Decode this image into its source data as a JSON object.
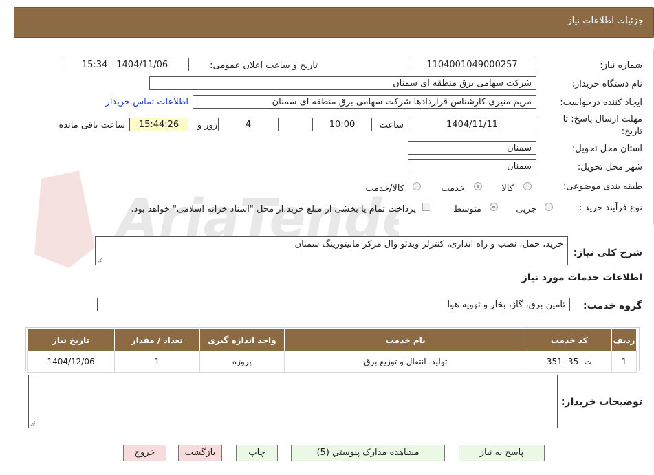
{
  "header": {
    "title": "جزئيات اطلاعات نياز"
  },
  "fields": {
    "need_number_label": "شماره نیاز:",
    "need_number": "1104001049000257",
    "announce_label": "تاریخ و ساعت اعلان عمومی:",
    "announce_value": "1404/11/06 - 15:34",
    "buyer_org_label": "نام دستگاه خریدار:",
    "buyer_org": "شرکت سهامی برق منطقه ای سمنان",
    "creator_label": "ایجاد کننده درخواست:",
    "creator": "مریم منیری کارشناس قراردادها شرکت سهامی برق منطقه ای سمنان",
    "contact_link": "اطلاعات تماس خریدار",
    "deadline_label": "مهلت ارسال پاسخ: تا",
    "deadline_label2": "تاریخ:",
    "deadline_date": "1404/11/11",
    "time_label": "ساعت",
    "deadline_time": "10:00",
    "days": "4",
    "days_label": "روز و",
    "remaining_time": "15:44:26",
    "remaining_label": "ساعت باقی مانده",
    "province_label": "استان محل تحویل:",
    "province": "سمنان",
    "city_label": "شهر محل تحویل:",
    "city": "سمنان",
    "category_label": "طبقه بندی موضوعی:",
    "category_options": [
      "کالا",
      "خدمت",
      "کالا/خدمت"
    ],
    "process_label": "نوع فرآیند خرید :",
    "process_options": [
      "جزیی",
      "متوسط"
    ],
    "payment_note": "پرداخت تمام یا بخشی از مبلغ خرید،از محل \"اسناد خزانه اسلامی\" خواهد بود."
  },
  "description": {
    "label": "شرح کلی نیاز:",
    "value": "خرید، حمل، نصب و راه اندازی، کنترلر ویدئو وال مرکز مانیتورینگ سمنان"
  },
  "services": {
    "title": "اطلاعات خدمات مورد نیاز",
    "group_label": "گروه خدمت:",
    "group_value": "تامین برق، گاز، بخار و تهویه هوا",
    "columns": [
      "ردیف",
      "کد خدمت",
      "نام خدمت",
      "واحد اندازه گیری",
      "تعداد / مقدار",
      "تاریخ نیاز"
    ],
    "rows": [
      [
        "1",
        "ت -35- 351",
        "تولید، انتقال و توزیع برق",
        "پروژه",
        "1",
        "1404/12/06"
      ]
    ]
  },
  "buyer_notes": {
    "label": "توضیحات خریدار:",
    "value": ""
  },
  "buttons": {
    "reply": "پاسخ به نیاز",
    "attachments": "مشاهده مدارک پیوستي (5)",
    "print": "چاپ",
    "back": "بازگشت",
    "exit": "خروج"
  },
  "watermark": {
    "text": "AriaTender.neT"
  },
  "colors": {
    "header_bg": "#8b6a44",
    "link": "#1a3cc8",
    "button_green": "#eaf8e4",
    "button_red": "#f8dcdc",
    "timer_bg": "#fdfbc9"
  }
}
